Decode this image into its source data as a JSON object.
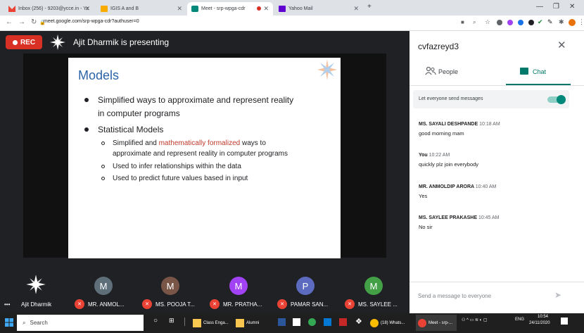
{
  "browser": {
    "tabs": [
      {
        "label": "Inbox (256) - 9203@ycce.in - Yc",
        "icon_color": "#ea4335"
      },
      {
        "label": "IGIS A and B",
        "icon_color": "#f9ab00"
      },
      {
        "label": "Meet - srp-wpga-cdr",
        "icon_color": "#00897b"
      },
      {
        "label": "Yahoo Mail",
        "icon_color": "#6001d2"
      }
    ],
    "new_tab": "+",
    "url": "meet.google.com/srp-wpga-cdr?authuser=0"
  },
  "meet": {
    "rec_label": "REC",
    "presenter_text": "Ajit Dharmik is presenting"
  },
  "slide": {
    "title": "Models",
    "bullet1": "Simplified ways to approximate and represent reality",
    "bullet1b": "in computer programs",
    "bullet2": "Statistical Models",
    "sub1_a": "Simplified and ",
    "sub1_hl": "mathematically formalized",
    "sub1_b": " ways to",
    "sub1_c": "approximate and represent reality in computer programs",
    "sub2": "Used to infer relationships within the data",
    "sub3": "Used to predict future values based in input"
  },
  "participants": [
    {
      "initial": "",
      "name": "Ajit Dharmik",
      "color": "#202124",
      "muted": false
    },
    {
      "initial": "M",
      "name": "MR. ANMOL...",
      "color": "#5f6f7a",
      "muted": true
    },
    {
      "initial": "M",
      "name": "MS. POOJA T...",
      "color": "#795548",
      "muted": true
    },
    {
      "initial": "M",
      "name": "MR. PRATHA...",
      "color": "#a142f4",
      "muted": true
    },
    {
      "initial": "P",
      "name": "PAMAR SAN...",
      "color": "#5c6bc0",
      "muted": true
    },
    {
      "initial": "M",
      "name": "MS. SAYLEE ...",
      "color": "#43a047",
      "muted": true
    }
  ],
  "more_dots": "•••",
  "chat": {
    "title": "cvfazreyd3",
    "tab_people": "People",
    "tab_chat": "Chat",
    "setting_label": "Let everyone send messages",
    "messages": [
      {
        "sender": "MS. SAYALI DESHPANDE",
        "time": "10:18 AM",
        "text": "good morning mam"
      },
      {
        "sender": "You",
        "time": "10:22 AM",
        "text": "quickly plz join everybody"
      },
      {
        "sender": "MR. ANMOLDIP ARORA",
        "time": "10:40 AM",
        "text": "Yes"
      },
      {
        "sender": "MS. SAYLEE PRAKASHE",
        "time": "10:45 AM",
        "text": "No sir"
      }
    ],
    "input_placeholder": "Send a message to everyone"
  },
  "taskbar": {
    "search": "Search",
    "items": [
      "Class Enga...",
      "Alumni",
      "(18) Whats...",
      "Meet - srp-..."
    ],
    "lang": "ENG",
    "time": "10:54",
    "date": "24/11/2020"
  }
}
